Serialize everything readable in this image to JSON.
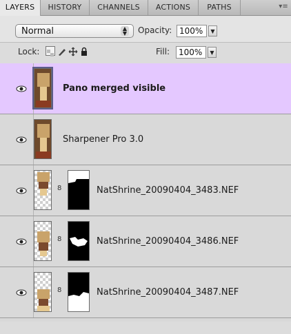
{
  "tabs": [
    "LAYERS",
    "HISTORY",
    "CHANNELS",
    "ACTIONS",
    "PATHS"
  ],
  "panel_menu_icon": "panel-menu-icon",
  "blend_mode": "Normal",
  "opacity_label": "Opacity:",
  "opacity_value": "100%",
  "lock_label": "Lock:",
  "fill_label": "Fill:",
  "fill_value": "100%",
  "layers": [
    {
      "name": "Pano merged visible",
      "selected": true,
      "has_mask": false
    },
    {
      "name": "Sharpener Pro 3.0",
      "selected": false,
      "has_mask": false
    },
    {
      "name": "NatShrine_20090404_3483.NEF",
      "selected": false,
      "has_mask": true
    },
    {
      "name": "NatShrine_20090404_3486.NEF",
      "selected": false,
      "has_mask": true
    },
    {
      "name": "NatShrine_20090404_3487.NEF",
      "selected": false,
      "has_mask": true
    }
  ],
  "colors": {
    "selected_row": "#e4c8ff",
    "panel_bg": "#d9d9d9"
  }
}
